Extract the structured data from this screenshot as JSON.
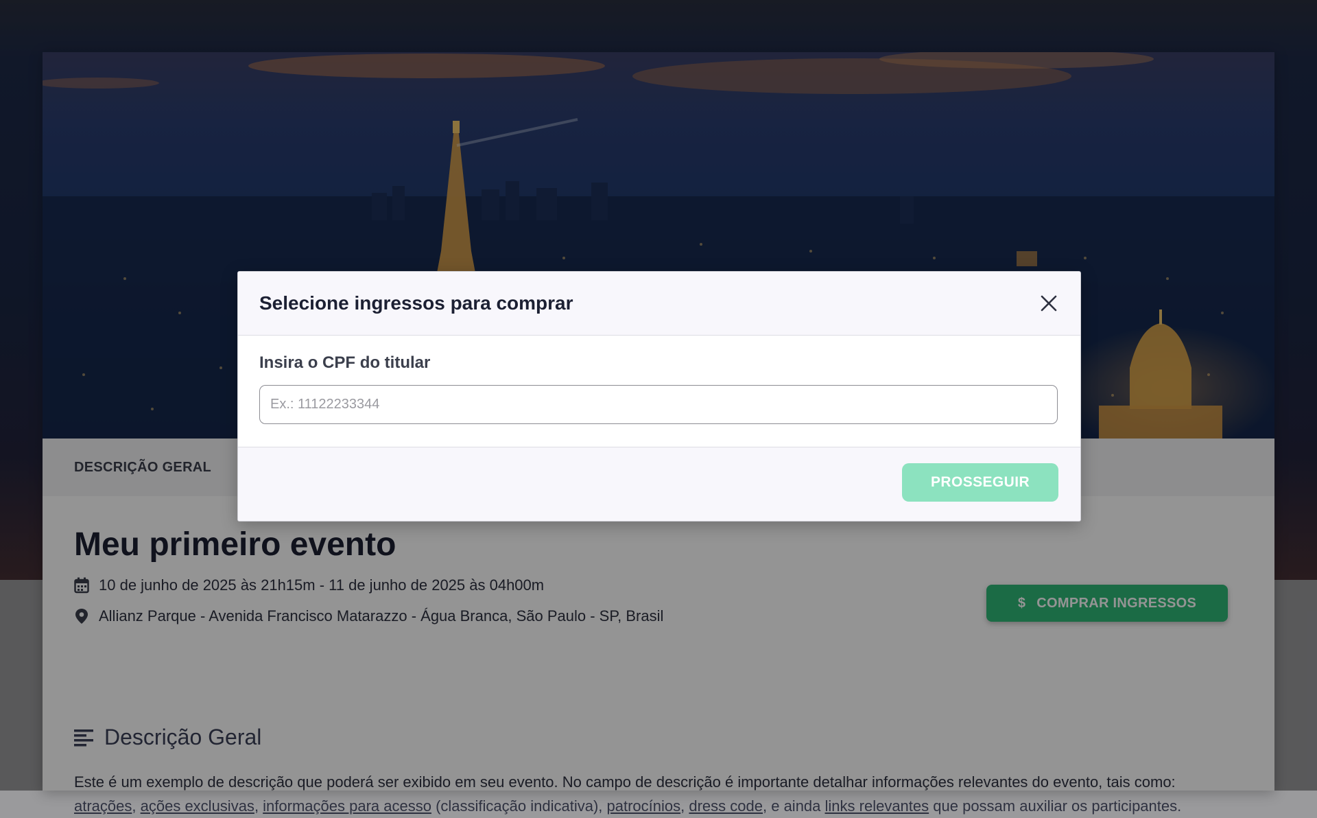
{
  "event": {
    "tab_label": "DESCRIÇÃO GERAL",
    "title": "Meu primeiro evento",
    "date_range": "10 de junho de 2025 às 21h15m - 11 de junho de 2025 às 04h00m",
    "location": "Allianz Parque - Avenida Francisco Matarazzo - Água Branca, São Paulo - SP, Brasil",
    "buy_button": {
      "icon": "$",
      "label": "COMPRAR INGRESSOS"
    },
    "section_title": "Descrição Geral",
    "description": {
      "t1": "Este é um exemplo de descrição que poderá ser exibido em seu evento. No campo de descrição é importante detalhar informações relevantes do evento, tais como: ",
      "link1": "atrações",
      "sep1": ", ",
      "link2": "ações exclusivas",
      "sep2": ", ",
      "link3": "informações para acesso",
      "t2": " (classificação indicativa), ",
      "link4": "patrocínios",
      "sep3": ", ",
      "link5": "dress code",
      "t3": ", e ainda ",
      "link6": "links relevantes",
      "t4": " que possam auxiliar os participantes."
    }
  },
  "modal": {
    "title": "Selecione ingressos para comprar",
    "field_label": "Insira o CPF do titular",
    "input_placeholder": "Ex.: 11122233344",
    "input_value": "",
    "proceed_label": "PROSSEGUIR"
  },
  "colors": {
    "accent_green": "#2fb877",
    "proceed_disabled": "#8ce2bf",
    "overlay": "rgba(0,0,0,0.42)"
  },
  "icons": {
    "close": "close-icon",
    "calendar": "calendar-icon",
    "location": "map-pin-icon",
    "dollar": "dollar-icon",
    "section": "align-left-icon"
  }
}
